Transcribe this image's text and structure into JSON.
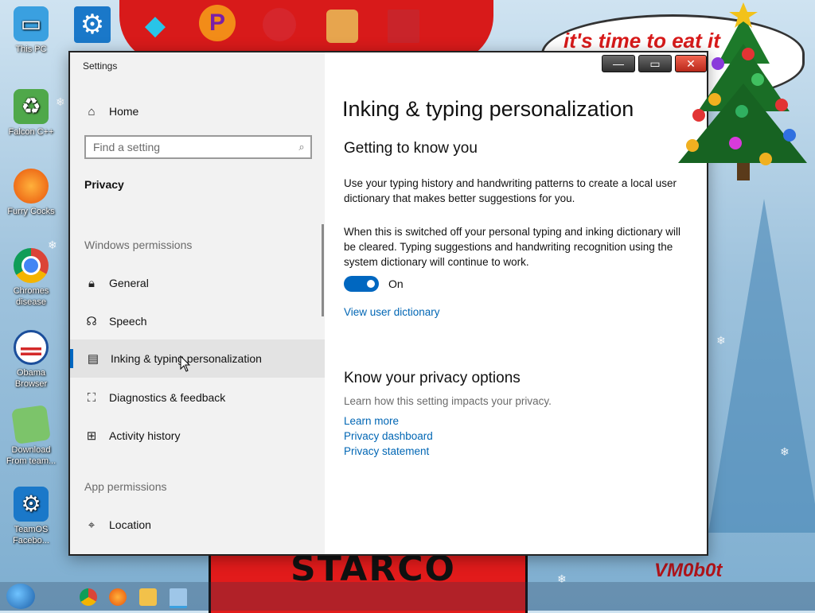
{
  "desktop": {
    "wallpaper_bubble_text": "it's time to eat it",
    "wallpaper_shirt_text": "STARCO",
    "wallpaper_signature": "VM0b0t",
    "icons": [
      {
        "label": "This PC"
      },
      {
        "label": "Falcon C++"
      },
      {
        "label": "Furry Cocks"
      },
      {
        "label": "Chromes disease"
      },
      {
        "label": "Obama Browser"
      },
      {
        "label": "Download From team..."
      },
      {
        "label": "TeamOS Facebo..."
      }
    ]
  },
  "window": {
    "title": "Settings",
    "controls": {
      "minimize": "—",
      "maximize": "▭",
      "close": "✕"
    }
  },
  "sidebar": {
    "home_label": "Home",
    "search_placeholder": "Find a setting",
    "category": "Privacy",
    "section_windows": "Windows permissions",
    "items": [
      {
        "label": "General",
        "icon": "lock-icon"
      },
      {
        "label": "Speech",
        "icon": "speech-icon"
      },
      {
        "label": "Inking & typing personalization",
        "icon": "clipboard-icon",
        "active": true
      },
      {
        "label": "Diagnostics & feedback",
        "icon": "feedback-icon"
      },
      {
        "label": "Activity history",
        "icon": "activity-icon"
      }
    ],
    "section_app": "App permissions",
    "app_items": [
      {
        "label": "Location",
        "icon": "location-icon"
      }
    ]
  },
  "main": {
    "title": "Inking & typing personalization",
    "section1": {
      "heading": "Getting to know you",
      "para1": "Use your typing history and handwriting patterns to create a local user dictionary that makes better suggestions for you.",
      "para2": "When this is switched off your personal typing and inking dictionary will be cleared. Typing suggestions and handwriting recognition using the system dictionary will continue to work.",
      "toggle_state": "On",
      "link": "View user dictionary"
    },
    "section2": {
      "heading": "Know your privacy options",
      "desc": "Learn how this setting impacts your privacy.",
      "links": [
        "Learn more",
        "Privacy dashboard",
        "Privacy statement"
      ]
    }
  },
  "colors": {
    "accent": "#0067c0",
    "link": "#0066b4",
    "sidebar_bg": "#f2f2f2"
  }
}
